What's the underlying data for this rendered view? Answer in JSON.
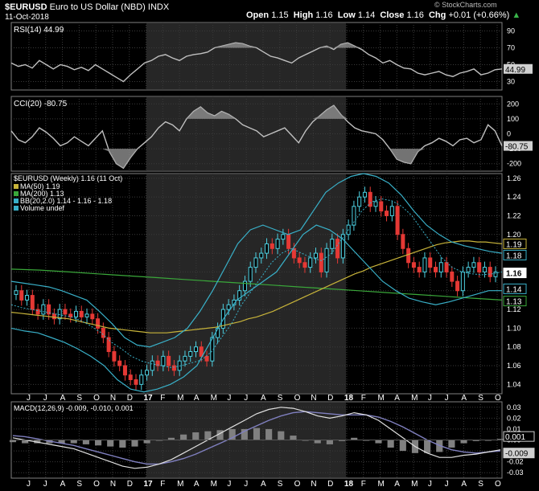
{
  "header": {
    "symbol": "$EURUSD",
    "name": "Euro to US Dollar (NBD)",
    "exchange": "INDX",
    "date": "11-Oct-2018",
    "open_label": "Open",
    "open": "1.15",
    "high_label": "High",
    "high": "1.16",
    "low_label": "Low",
    "low": "1.14",
    "close_label": "Close",
    "close": "1.16",
    "chg_label": "Chg",
    "chg": "+0.01 (+0.66%)",
    "credit": "© StockCharts.com"
  },
  "colors": {
    "background": "#000000",
    "shade": "#262626",
    "grid": "#3a3a3a",
    "up": "#4dd0e1",
    "down": "#e53935",
    "bb": "#39b0c8",
    "ma50": "#c8b43a",
    "ma200": "#3aa83a",
    "rsi": "#c0c0c0",
    "macd": "#e0e0e0",
    "signal": "#8080c0",
    "hist": "#808080"
  },
  "x_axis": {
    "labels": [
      "J",
      "J",
      "A",
      "S",
      "O",
      "N",
      "D",
      "17",
      "F",
      "M",
      "A",
      "M",
      "J",
      "J",
      "A",
      "S",
      "O",
      "N",
      "D",
      "18",
      "F",
      "M",
      "A",
      "M",
      "J",
      "J",
      "A",
      "S",
      "O"
    ]
  },
  "chart_data": [
    {
      "type": "line",
      "name": "rsi",
      "title": "RSI(14) 44.99",
      "ylim": [
        20,
        100
      ],
      "ticks": [
        90,
        70,
        50,
        30
      ],
      "current_label": "44.99",
      "grid": true,
      "values": [
        52,
        48,
        50,
        46,
        55,
        50,
        45,
        50,
        48,
        44,
        47,
        43,
        50,
        45,
        40,
        35,
        30,
        38,
        45,
        52,
        55,
        60,
        62,
        58,
        55,
        60,
        62,
        63,
        65,
        70,
        72,
        74,
        76,
        75,
        72,
        70,
        65,
        60,
        58,
        55,
        52,
        58,
        62,
        66,
        70,
        72,
        68,
        74,
        76,
        72,
        68,
        62,
        58,
        52,
        55,
        50,
        46,
        45,
        40,
        38,
        40,
        42,
        38,
        36,
        40,
        42,
        45,
        38,
        40,
        44,
        45
      ]
    },
    {
      "type": "line",
      "name": "cci",
      "title": "CCI(20) -80.75",
      "ylim": [
        -250,
        250
      ],
      "ticks": [
        200,
        100,
        0,
        -100,
        -200
      ],
      "current_label": "-80.75",
      "grid": true,
      "values": [
        20,
        -40,
        -60,
        -20,
        40,
        10,
        -30,
        -80,
        -60,
        -20,
        -50,
        -80,
        -30,
        20,
        -120,
        -200,
        -230,
        -160,
        -100,
        -60,
        -20,
        40,
        80,
        60,
        20,
        100,
        150,
        180,
        140,
        120,
        150,
        130,
        100,
        60,
        40,
        20,
        -20,
        0,
        20,
        40,
        -10,
        -60,
        20,
        80,
        120,
        160,
        190,
        130,
        80,
        40,
        20,
        10,
        0,
        -40,
        -100,
        -170,
        -190,
        -200,
        -120,
        -80,
        -60,
        -30,
        -50,
        -80,
        -40,
        -30,
        -60,
        -40,
        60,
        20,
        -81
      ]
    },
    {
      "type": "candlestick",
      "name": "price",
      "title": "$EURUSD (Weekly) 1.16 (11 Oct)",
      "ylim": [
        1.03,
        1.265
      ],
      "ticks": [
        1.26,
        1.24,
        1.22,
        1.2,
        1.18,
        1.16,
        1.14,
        1.12,
        1.1,
        1.08,
        1.06,
        1.04
      ],
      "grid": true,
      "legend": [
        {
          "name": "MA(50) 1.19",
          "value": "1.19",
          "color": "#c8b43a"
        },
        {
          "name": "MA(200) 1.13",
          "value": "1.13",
          "color": "#3aa83a"
        },
        {
          "name": "BB(20,2.0) 1.14 - 1.16 - 1.18",
          "value": "1.18",
          "color": "#39b0c8"
        },
        {
          "name": "Volume undef",
          "value": "",
          "color": "#39b0c8"
        }
      ],
      "price_tags": [
        {
          "value": "1.19",
          "y": 1.19,
          "color": "#c8b43a"
        },
        {
          "value": "1.18",
          "y": 1.178,
          "color": "#39b0c8"
        },
        {
          "value": "1.16",
          "y": 1.159,
          "color": "#ffffff"
        },
        {
          "value": "1.14",
          "y": 1.142,
          "color": "#39b0c8"
        },
        {
          "value": "1.13",
          "y": 1.129,
          "color": "#3aa83a"
        }
      ],
      "close": [
        1.14,
        1.13,
        1.135,
        1.12,
        1.115,
        1.125,
        1.115,
        1.11,
        1.12,
        1.115,
        1.112,
        1.118,
        1.112,
        1.115,
        1.11,
        1.1,
        1.09,
        1.075,
        1.065,
        1.06,
        1.05,
        1.045,
        1.04,
        1.05,
        1.055,
        1.065,
        1.06,
        1.07,
        1.06,
        1.055,
        1.065,
        1.07,
        1.075,
        1.08,
        1.07,
        1.065,
        1.09,
        1.1,
        1.12,
        1.125,
        1.13,
        1.14,
        1.15,
        1.165,
        1.175,
        1.18,
        1.19,
        1.185,
        1.195,
        1.2,
        1.185,
        1.175,
        1.17,
        1.165,
        1.175,
        1.18,
        1.16,
        1.185,
        1.195,
        1.175,
        1.2,
        1.21,
        1.23,
        1.24,
        1.245,
        1.23,
        1.235,
        1.225,
        1.22,
        1.23,
        1.2,
        1.185,
        1.17,
        1.165,
        1.16,
        1.175,
        1.165,
        1.16,
        1.17,
        1.16,
        1.15,
        1.14,
        1.16,
        1.165,
        1.17,
        1.16,
        1.165,
        1.155,
        1.16
      ],
      "ma50": [
        1.117,
        1.116,
        1.115,
        1.114,
        1.113,
        1.112,
        1.111,
        1.11,
        1.108,
        1.106,
        1.104,
        1.102,
        1.1,
        1.099,
        1.098,
        1.097,
        1.096,
        1.095,
        1.095,
        1.095,
        1.096,
        1.097,
        1.098,
        1.099,
        1.1,
        1.101,
        1.103,
        1.105,
        1.107,
        1.11,
        1.112,
        1.115,
        1.118,
        1.122,
        1.126,
        1.13,
        1.134,
        1.138,
        1.142,
        1.146,
        1.15,
        1.154,
        1.158,
        1.161,
        1.165,
        1.168,
        1.171,
        1.174,
        1.177,
        1.18,
        1.183,
        1.186,
        1.189,
        1.191,
        1.192,
        1.193,
        1.193,
        1.192,
        1.192,
        1.191,
        1.19
      ],
      "ma200": [
        1.163,
        1.162,
        1.16,
        1.158,
        1.156,
        1.154,
        1.152,
        1.15,
        1.148,
        1.146,
        1.144,
        1.142,
        1.14,
        1.138,
        1.136,
        1.134,
        1.132,
        1.13
      ],
      "bb_mid": [
        1.125,
        1.122,
        1.12,
        1.118,
        1.116,
        1.114,
        1.112,
        1.108,
        1.102,
        1.095,
        1.085,
        1.078,
        1.07,
        1.065,
        1.062,
        1.06,
        1.058,
        1.06,
        1.063,
        1.066,
        1.075,
        1.09,
        1.105,
        1.125,
        1.14,
        1.155,
        1.17,
        1.18,
        1.185,
        1.18,
        1.175,
        1.172,
        1.18,
        1.195,
        1.21,
        1.225,
        1.235,
        1.238,
        1.236,
        1.23,
        1.22,
        1.205,
        1.19,
        1.175,
        1.165,
        1.16,
        1.158,
        1.157,
        1.158,
        1.16
      ],
      "bb_upper": [
        1.15,
        1.148,
        1.146,
        1.144,
        1.14,
        1.135,
        1.13,
        1.118,
        1.105,
        1.09,
        1.082,
        1.08,
        1.085,
        1.09,
        1.1,
        1.118,
        1.14,
        1.165,
        1.19,
        1.205,
        1.21,
        1.205,
        1.2,
        1.205,
        1.225,
        1.245,
        1.255,
        1.262,
        1.265,
        1.262,
        1.255,
        1.242,
        1.225,
        1.21,
        1.2,
        1.192,
        1.188,
        1.185,
        1.182,
        1.18
      ],
      "bb_lower": [
        1.1,
        1.097,
        1.095,
        1.09,
        1.085,
        1.078,
        1.07,
        1.06,
        1.045,
        1.035,
        1.032,
        1.035,
        1.04,
        1.048,
        1.06,
        1.085,
        1.11,
        1.13,
        1.14,
        1.15,
        1.16,
        1.18,
        1.2,
        1.21,
        1.205,
        1.195,
        1.18,
        1.165,
        1.15,
        1.14,
        1.132,
        1.128,
        1.125,
        1.128,
        1.132,
        1.136,
        1.14,
        1.14
      ]
    },
    {
      "type": "line",
      "name": "macd",
      "title": "MACD(12,26,9) -0.009, -0.010, 0.001",
      "ylim": [
        -0.035,
        0.035
      ],
      "ticks": [
        0.03,
        0.02,
        0.01,
        0.0,
        -0.01,
        -0.02,
        -0.03
      ],
      "current_labels": [
        "0.001",
        "-0.009"
      ],
      "grid": true,
      "macd": [
        0.002,
        0.0,
        -0.002,
        -0.004,
        -0.006,
        -0.008,
        -0.012,
        -0.016,
        -0.02,
        -0.024,
        -0.026,
        -0.025,
        -0.022,
        -0.018,
        -0.012,
        -0.006,
        0.0,
        0.006,
        0.012,
        0.018,
        0.024,
        0.028,
        0.03,
        0.029,
        0.026,
        0.022,
        0.02,
        0.022,
        0.025,
        0.023,
        0.018,
        0.01,
        0.002,
        -0.006,
        -0.012,
        -0.016,
        -0.016,
        -0.014,
        -0.013,
        -0.011,
        -0.009
      ],
      "signal": [
        0.004,
        0.003,
        0.001,
        -0.001,
        -0.003,
        -0.005,
        -0.008,
        -0.011,
        -0.014,
        -0.017,
        -0.02,
        -0.022,
        -0.022,
        -0.02,
        -0.017,
        -0.013,
        -0.008,
        -0.003,
        0.002,
        0.008,
        0.013,
        0.018,
        0.022,
        0.025,
        0.026,
        0.025,
        0.024,
        0.023,
        0.023,
        0.023,
        0.021,
        0.017,
        0.012,
        0.006,
        0.0,
        -0.005,
        -0.009,
        -0.011,
        -0.012,
        -0.011,
        -0.01
      ]
    }
  ]
}
